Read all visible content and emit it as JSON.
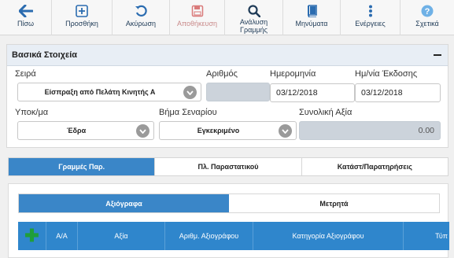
{
  "toolbar": {
    "buttons": [
      {
        "label": "Πίσω"
      },
      {
        "label": "Προσθήκη"
      },
      {
        "label": "Ακύρωση"
      },
      {
        "label": "Αποθήκευση"
      },
      {
        "label": "Ανάλυση\nΓραμμής"
      },
      {
        "label": "Μηνύματα"
      },
      {
        "label": "Ενέργειες"
      },
      {
        "label": "Σχετικά"
      }
    ]
  },
  "basic": {
    "title": "Βασικά Στοιχεία",
    "series_label": "Σειρά",
    "series_value": "Είσπραξη από Πελάτη Κινητής Α",
    "number_label": "Αριθμός",
    "number_value": "",
    "date_label": "Ημερομηνία",
    "date_value": "03/12/2018",
    "issue_label": "Ημ/νία Έκδοσης",
    "issue_value": "03/12/2018",
    "branch_label": "Υποκ/μα",
    "branch_value": "Έδρα",
    "step_label": "Βήμα Σεναρίου",
    "step_value": "Εγκεκριμένο",
    "total_label": "Συνολική Αξία",
    "total_value": "0.00"
  },
  "tabs": [
    {
      "label": "Γραμμές Παρ."
    },
    {
      "label": "Πλ. Παραστατικού"
    },
    {
      "label": "Κατάστ/Παρατηρήσεις"
    }
  ],
  "subtabs": [
    {
      "label": "Αξιόγραφα"
    },
    {
      "label": "Μετρητά"
    }
  ],
  "grid": {
    "add_symbol": "✚",
    "columns": [
      "Α/Α",
      "Αξία",
      "Αριθμ. Αξιογράφου",
      "Κατηγορία Αξιογράφου",
      "Τύπ"
    ]
  },
  "colors": {
    "accent": "#3a86c8",
    "grid_header": "#2f86cc",
    "add_green": "#1f9e3a",
    "icon_blue": "#2b6cb0",
    "icon_disabled": "#d97a7a"
  }
}
